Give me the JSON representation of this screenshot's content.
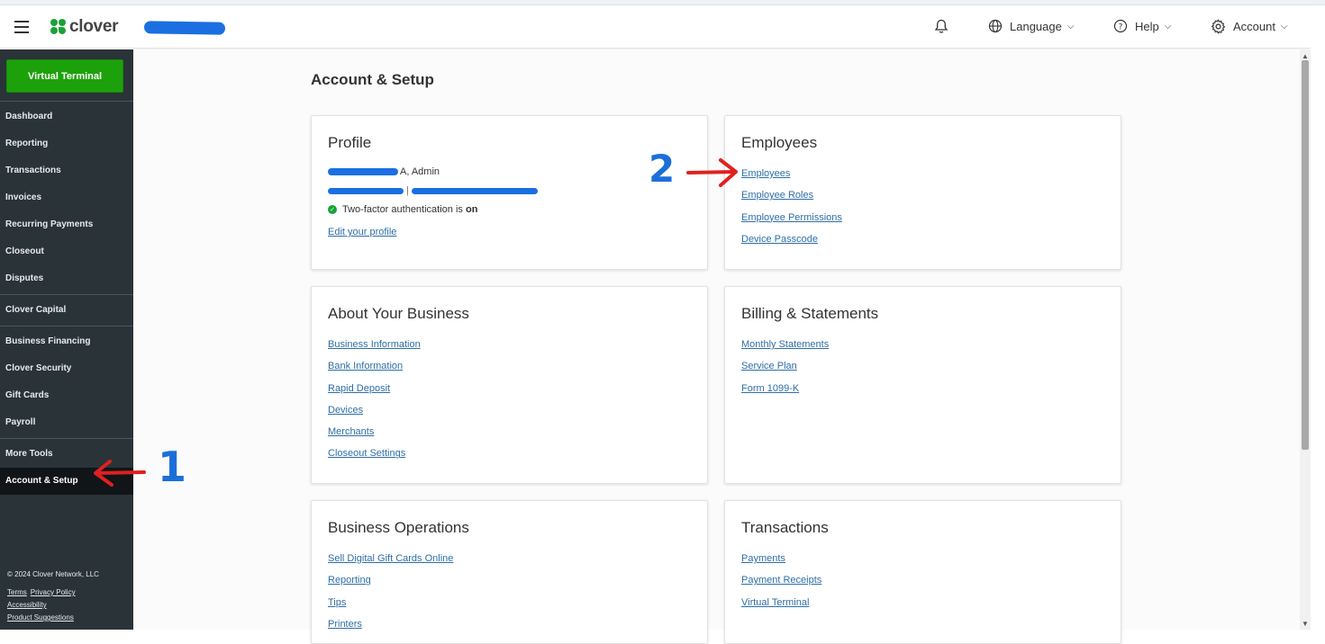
{
  "header": {
    "logo_text": "clover",
    "language_label": "Language",
    "help_label": "Help",
    "account_label": "Account"
  },
  "sidebar": {
    "virtual_terminal_label": "Virtual Terminal",
    "groups": [
      [
        "Dashboard",
        "Reporting",
        "Transactions",
        "Invoices",
        "Recurring Payments",
        "Closeout",
        "Disputes"
      ],
      [
        "Clover Capital"
      ],
      [
        "Business Financing",
        "Clover Security",
        "Gift Cards",
        "Payroll"
      ],
      [
        "More Tools"
      ]
    ],
    "active_item": "Account & Setup",
    "footer": {
      "copyright": "© 2024 Clover Network, LLC",
      "terms": "Terms",
      "privacy": "Privacy Policy",
      "accessibility": "Accessibility",
      "suggestions": "Product Suggestions"
    }
  },
  "page": {
    "title": "Account & Setup"
  },
  "profile": {
    "title": "Profile",
    "role_suffix": "A, Admin",
    "twofa_text": "Two-factor authentication is",
    "twofa_state": "on",
    "edit_link": "Edit your profile"
  },
  "cards": {
    "employees": {
      "title": "Employees",
      "links": [
        "Employees",
        "Employee Roles",
        "Employee Permissions",
        "Device Passcode"
      ]
    },
    "about": {
      "title": "About Your Business",
      "links": [
        "Business Information",
        "Bank Information",
        "Rapid Deposit",
        "Devices",
        "Merchants",
        "Closeout Settings"
      ]
    },
    "billing": {
      "title": "Billing & Statements",
      "links": [
        "Monthly Statements",
        "Service Plan",
        "Form 1099-K"
      ]
    },
    "operations": {
      "title": "Business Operations",
      "links": [
        "Sell Digital Gift Cards Online",
        "Reporting",
        "Tips",
        "Printers"
      ]
    },
    "transactions": {
      "title": "Transactions",
      "links": [
        "Payments",
        "Payment Receipts",
        "Virtual Terminal"
      ]
    }
  },
  "annotations": {
    "step1": "1",
    "step2": "2",
    "arrow_color": "#e02020",
    "number_color": "#1c6fd8"
  },
  "colors": {
    "brand_green": "#1da10b",
    "sidebar_bg": "#2a3338",
    "link_blue": "#2e6ea6"
  },
  "icons": {
    "menu": "hamburger-icon",
    "notifications": "bell-icon",
    "language": "globe-icon",
    "help": "question-circle-icon",
    "account": "gear-icon"
  }
}
